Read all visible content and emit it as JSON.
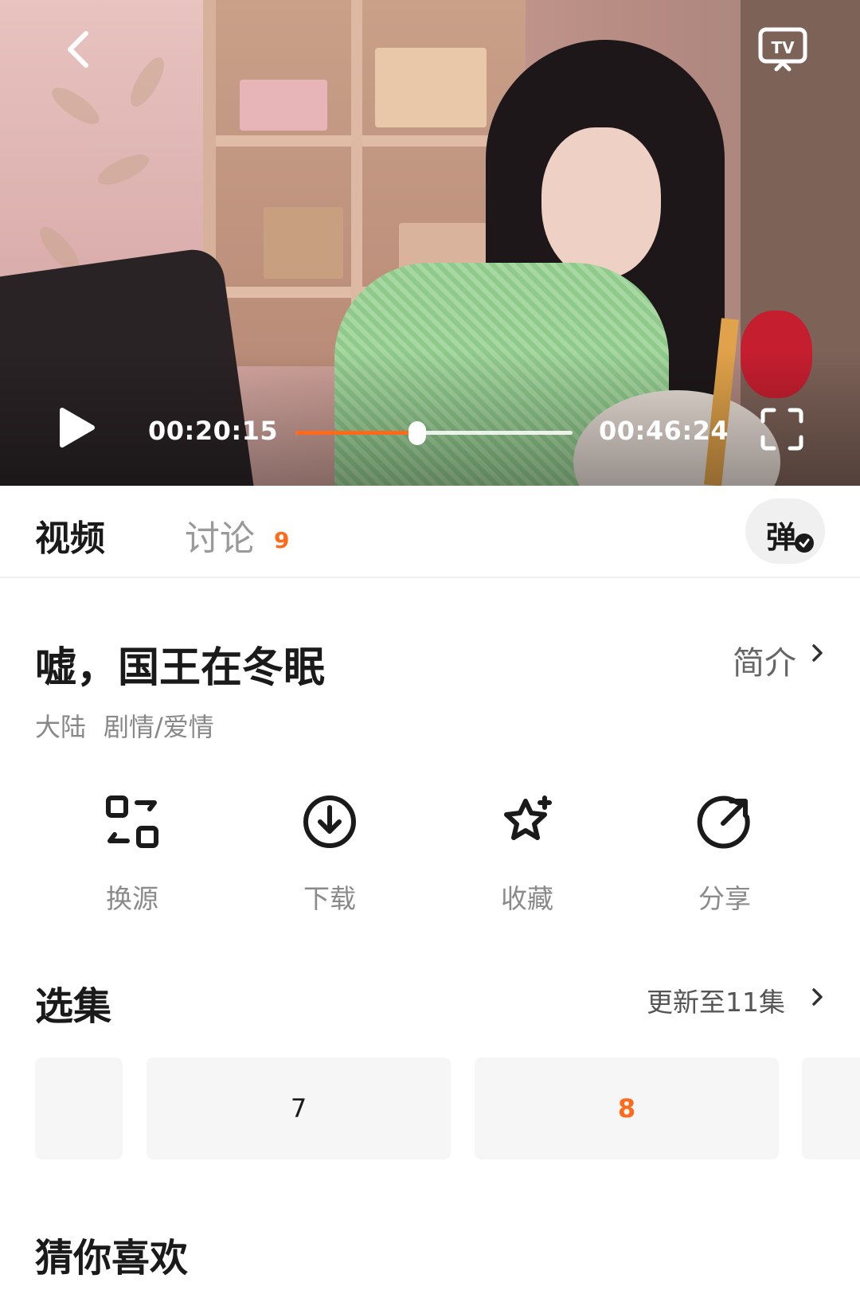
{
  "player": {
    "current_time": "00:20:15",
    "total_time": "00:46:24",
    "progress": 0.44,
    "icons": [
      "back-icon",
      "tv-cast-icon",
      "play-icon",
      "fullscreen-icon"
    ]
  },
  "tabs": {
    "video_label": "视频",
    "discuss_label": "讨论",
    "discuss_count": "9",
    "danmaku_label": "弹"
  },
  "show": {
    "title": "嘘，国王在冬眠",
    "intro_label": "简介",
    "region": "大陆",
    "genre": "剧情/爱情"
  },
  "actions": [
    {
      "label": "换源",
      "icon": "switch-source-icon"
    },
    {
      "label": "下载",
      "icon": "download-icon"
    },
    {
      "label": "收藏",
      "icon": "favorite-icon"
    },
    {
      "label": "分享",
      "icon": "share-icon"
    }
  ],
  "episodes": {
    "title": "选集",
    "update_label": "更新至11集",
    "items": [
      {
        "label": ""
      },
      {
        "label": "7"
      },
      {
        "label": "8",
        "active": true
      },
      {
        "label": ""
      }
    ]
  },
  "recommend": {
    "title": "猜你喜欢"
  },
  "colors": {
    "accent": "#ff6a1a",
    "text_primary": "#1a1a1a",
    "text_secondary": "#8a8a8a"
  }
}
